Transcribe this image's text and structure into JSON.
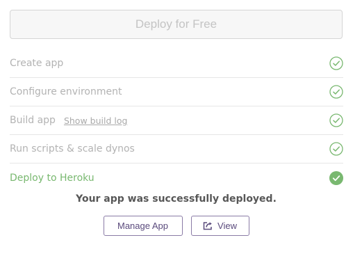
{
  "deploy_button": {
    "label": "Deploy for Free"
  },
  "steps": [
    {
      "label": "Create app",
      "status": "complete"
    },
    {
      "label": "Configure environment",
      "status": "complete"
    },
    {
      "label": "Build app",
      "link": "Show build log",
      "status": "complete"
    },
    {
      "label": "Run scripts & scale dynos",
      "status": "complete"
    },
    {
      "label": "Deploy to Heroku",
      "status": "success"
    }
  ],
  "result": {
    "message": "Your app was successfully deployed.",
    "manage_label": "Manage App",
    "view_label": "View"
  },
  "colors": {
    "success_green": "#79b870",
    "heroku_purple": "#5a4a7c",
    "muted_text": "#b3b3b3"
  },
  "icons": {
    "step_complete": "check-circle-outline-icon",
    "step_success": "check-circle-filled-icon",
    "view": "external-link-icon"
  }
}
